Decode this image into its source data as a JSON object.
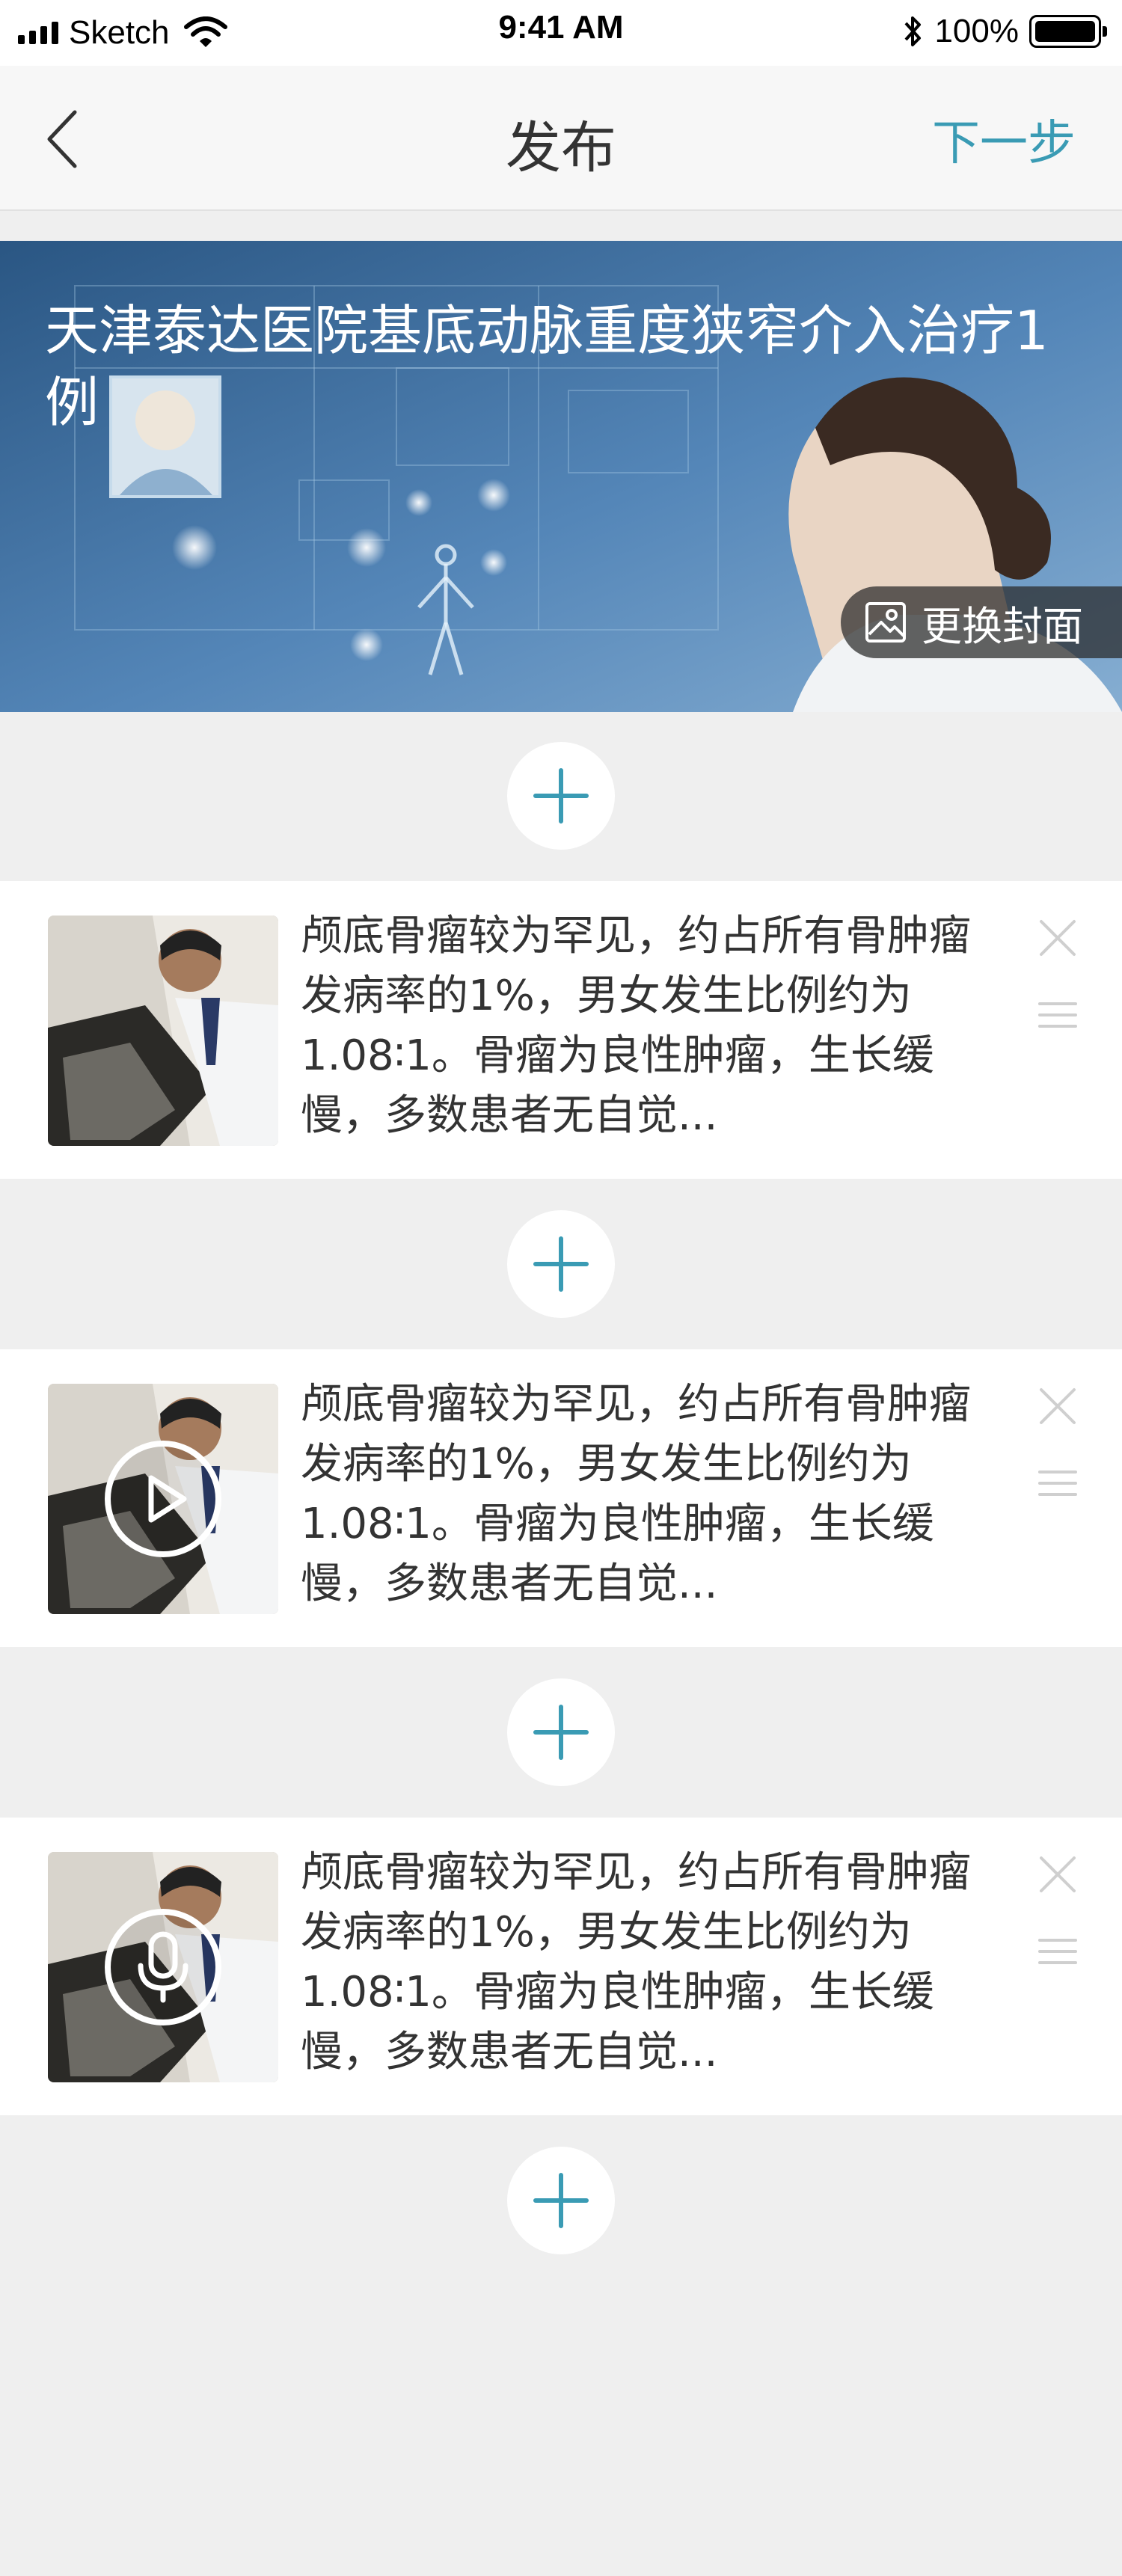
{
  "status_bar": {
    "carrier": "Sketch",
    "time": "9:41 AM",
    "battery": "100%"
  },
  "nav": {
    "title": "发布",
    "next_label": "下一步",
    "accent_color": "#3a9bb4"
  },
  "cover": {
    "title": "天津泰达医院基底动脉重度狭窄介入治疗1例",
    "change_cover_label": "更换封面"
  },
  "cards": [
    {
      "text": "颅底骨瘤较为罕见，约占所有骨肿瘤发病率的1%，男女发生比例约为1.08∶1。骨瘤为良性肿瘤，生长缓慢，多数患者无自觉...",
      "media_type": "image"
    },
    {
      "text": "颅底骨瘤较为罕见，约占所有骨肿瘤发病率的1%，男女发生比例约为1.08∶1。骨瘤为良性肿瘤，生长缓慢，多数患者无自觉...",
      "media_type": "video",
      "overlay_icon": "play-icon"
    },
    {
      "text": "颅底骨瘤较为罕见，约占所有骨肿瘤发病率的1%，男女发生比例约为1.08∶1。骨瘤为良性肿瘤，生长缓慢，多数患者无自觉...",
      "media_type": "audio",
      "overlay_icon": "microphone-icon"
    }
  ]
}
